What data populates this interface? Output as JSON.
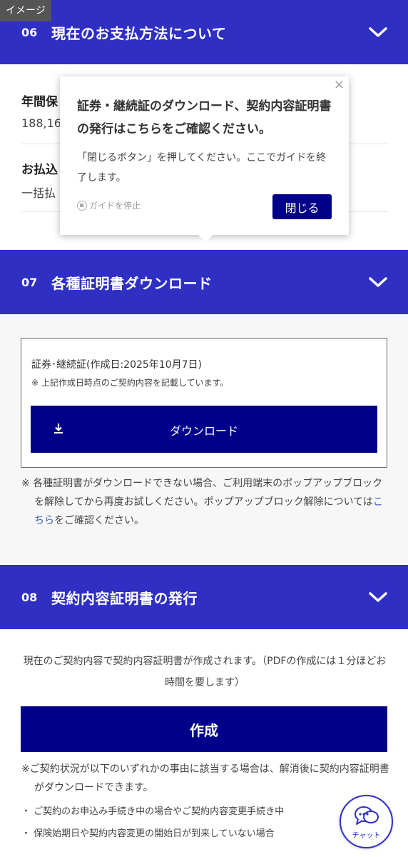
{
  "badge": "イメージ",
  "sections": {
    "s06": {
      "num": "06",
      "title": "現在のお支払方法について"
    },
    "s07": {
      "num": "07",
      "title": "各種証明書ダウンロード"
    },
    "s08": {
      "num": "08",
      "title": "契約内容証明書の発行"
    }
  },
  "payment": {
    "row1_label": "年間保",
    "row1_value": "188,16",
    "row2_label": "お払込",
    "row2_value": "一括払"
  },
  "popover": {
    "close": "×",
    "title": "証券・継続証のダウンロード、契約内容証明書の発行はこちらをご確認ください。",
    "desc": "「閉じるボタン」を押してください。ここでガイドを終了します。",
    "stop_label": "ガイドを停止",
    "close_button": "閉じる"
  },
  "certificate": {
    "title": "証券･継続証(作成日:2025年10月7日)",
    "note": "※ 上記作成日時点のご契約内容を記載しています。",
    "download_label": "ダウンロード"
  },
  "popup_note": {
    "before": "※ 各種証明書がダウンロードできない場合、ご利用端末のポップアップブロックを解除してから再度お試しください。ポップアップブロック解除については",
    "link": "こちら",
    "after": "をご確認ください。"
  },
  "issue": {
    "desc": "現在のご契約内容で契約内容証明書が作成されます。（PDFの作成には１分ほどお時間を要します）",
    "create_label": "作成",
    "note": "※ご契約状況が以下のいずれかの事由に該当する場合は、解消後に契約内容証明書がダウンロードできます。",
    "bullets": [
      "・ ご契約のお申込み手続き中の場合やご契約内容変更手続き中",
      "・ 保険始期日や契約内容変更の開始日が到来していない場合"
    ]
  },
  "chat": {
    "label": "チャット"
  },
  "colors": {
    "header": "#2f2fc4",
    "button": "#000088",
    "link": "#3a5fd0"
  }
}
